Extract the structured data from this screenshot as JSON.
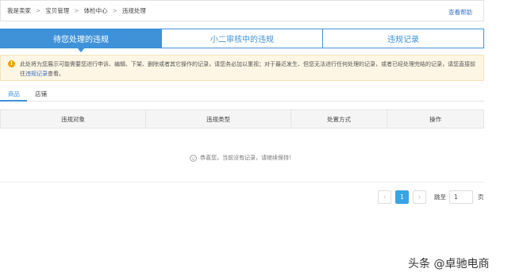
{
  "breadcrumb": {
    "items": [
      "我是卖家",
      "宝贝管理",
      "体检中心",
      "违规处理"
    ],
    "separator": ">",
    "help_label": "查看帮助"
  },
  "tabs": [
    {
      "label": "待您处理的违规",
      "active": true
    },
    {
      "label": "小二审核中的违规",
      "active": false
    },
    {
      "label": "违规记录",
      "active": false
    }
  ],
  "notice": {
    "icon": "warning-icon",
    "text_before": "此处将为您展示可能需要您进行申诉、编辑、下架、删除或者其它操作的记录，请您务必加以重视；对于最近发生、但您无法进行任何处理的记录，或者已经处理完结的记录，请您直接前往",
    "link_label": "违规记录",
    "text_after": "查看。"
  },
  "subtabs": [
    {
      "label": "商品",
      "active": true
    },
    {
      "label": "店铺",
      "active": false
    }
  ],
  "table": {
    "columns": [
      "违规对象",
      "违规类型",
      "处置方式",
      "操作"
    ]
  },
  "empty_state": {
    "icon": "smile-icon",
    "text": "恭喜您，当前没有记录，请继续保持！"
  },
  "pagination": {
    "prev": "‹",
    "current_page": "1",
    "next": "›",
    "goto_label": "跳至",
    "goto_value": "1",
    "unit_label": "页"
  },
  "watermark": "头条 @卓驰电商",
  "colors": {
    "accent": "#3f92d8",
    "notice_bg": "#fdf6e5",
    "warning": "#f0a400",
    "page_active": "#39a3e3"
  }
}
